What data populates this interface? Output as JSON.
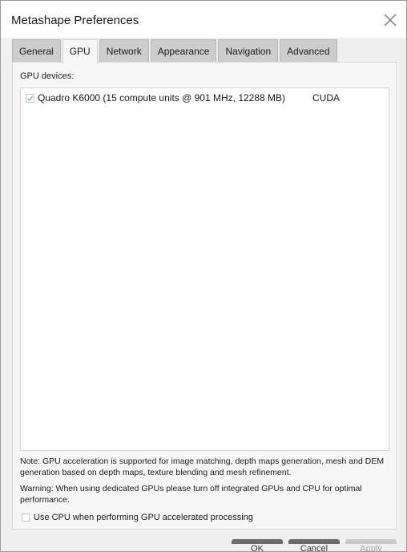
{
  "window": {
    "title": "Metashape Preferences",
    "close_icon": "close-icon"
  },
  "tabs": [
    {
      "label": "General",
      "active": false
    },
    {
      "label": "GPU",
      "active": true
    },
    {
      "label": "Network",
      "active": false
    },
    {
      "label": "Appearance",
      "active": false
    },
    {
      "label": "Navigation",
      "active": false
    },
    {
      "label": "Advanced",
      "active": false
    }
  ],
  "gpu": {
    "devices_label": "GPU devices:",
    "devices": [
      {
        "name": "Quadro K6000 (15 compute units @ 901 MHz, 12288 MB)",
        "api": "CUDA",
        "checked": true
      }
    ],
    "note": "Note: GPU acceleration is supported for image matching, depth maps generation, mesh and DEM generation based on depth maps, texture blending and mesh refinement.",
    "warning": "Warning: When using dedicated GPUs please turn off integrated GPUs and CPU for optimal performance.",
    "use_cpu_label": "Use CPU when performing GPU accelerated processing",
    "use_cpu_checked": false
  },
  "buttons": {
    "ok": "OK",
    "cancel": "Cancel",
    "apply": "Apply"
  },
  "colors": {
    "check_mark": "#66bb6a",
    "tab_inactive": "#cdcdcd",
    "panel_bg": "#f7f7f7"
  }
}
